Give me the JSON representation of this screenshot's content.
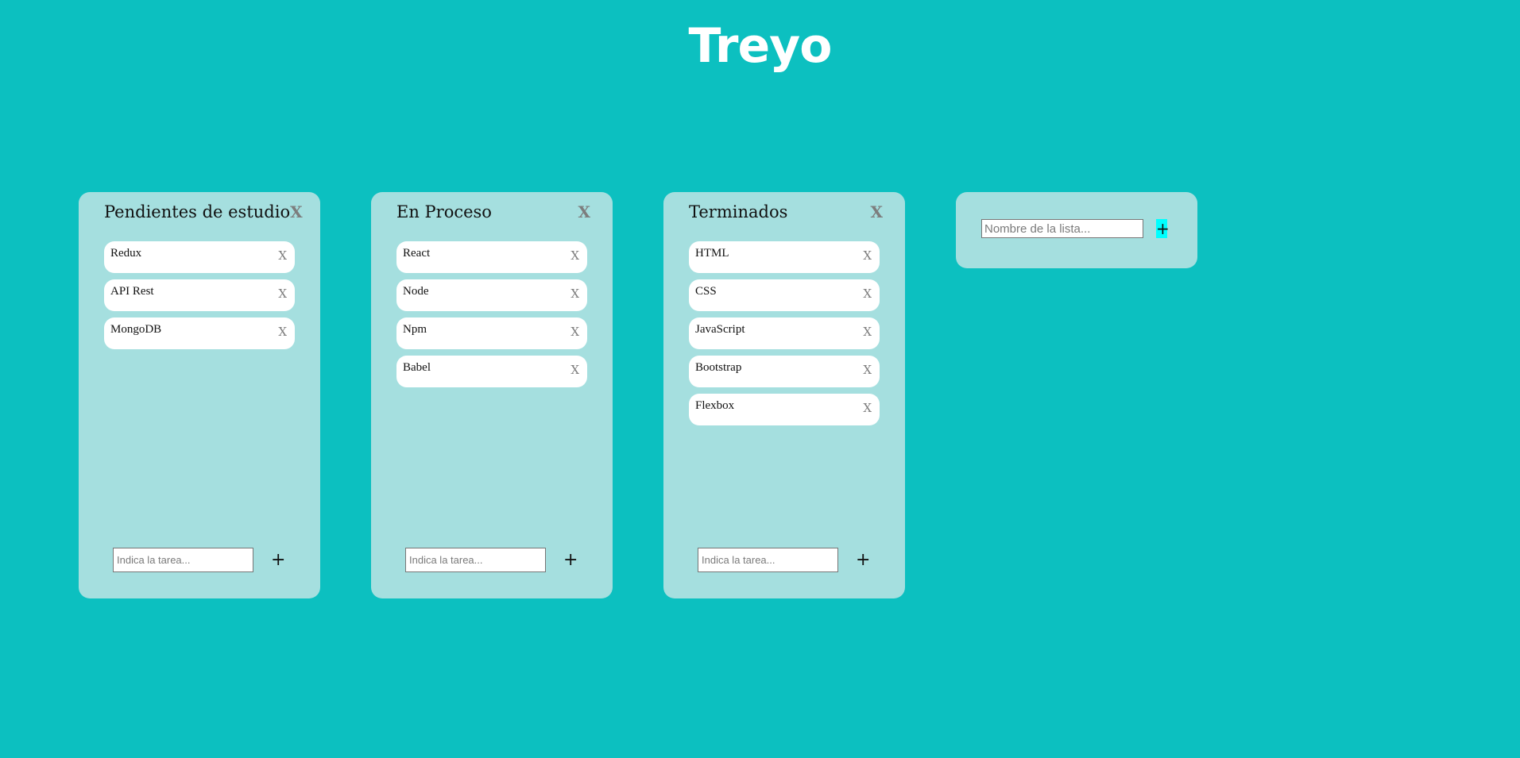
{
  "app": {
    "title": "Treyo"
  },
  "colors": {
    "background": "#0cc0c0",
    "list_background": "#a5dfdf",
    "task_background": "#ffffff",
    "add_list_button": "#00ffff"
  },
  "lists": [
    {
      "title": "Pendientes de estudio",
      "close_label": "X",
      "tasks": [
        {
          "label": "Redux",
          "delete_label": "X"
        },
        {
          "label": "API Rest",
          "delete_label": "X"
        },
        {
          "label": "MongoDB",
          "delete_label": "X"
        }
      ],
      "input_placeholder": "Indica la tarea...",
      "add_label": "+"
    },
    {
      "title": "En Proceso",
      "close_label": "X",
      "tasks": [
        {
          "label": "React",
          "delete_label": "X"
        },
        {
          "label": "Node",
          "delete_label": "X"
        },
        {
          "label": "Npm",
          "delete_label": "X"
        },
        {
          "label": "Babel",
          "delete_label": "X"
        }
      ],
      "input_placeholder": "Indica la tarea...",
      "add_label": "+"
    },
    {
      "title": "Terminados",
      "close_label": "X",
      "tasks": [
        {
          "label": "HTML",
          "delete_label": "X"
        },
        {
          "label": "CSS",
          "delete_label": "X"
        },
        {
          "label": "JavaScript",
          "delete_label": "X"
        },
        {
          "label": "Bootstrap",
          "delete_label": "X"
        },
        {
          "label": "Flexbox",
          "delete_label": "X"
        }
      ],
      "input_placeholder": "Indica la tarea...",
      "add_label": "+"
    }
  ],
  "new_list": {
    "input_placeholder": "Nombre de la lista...",
    "add_label": "+"
  }
}
